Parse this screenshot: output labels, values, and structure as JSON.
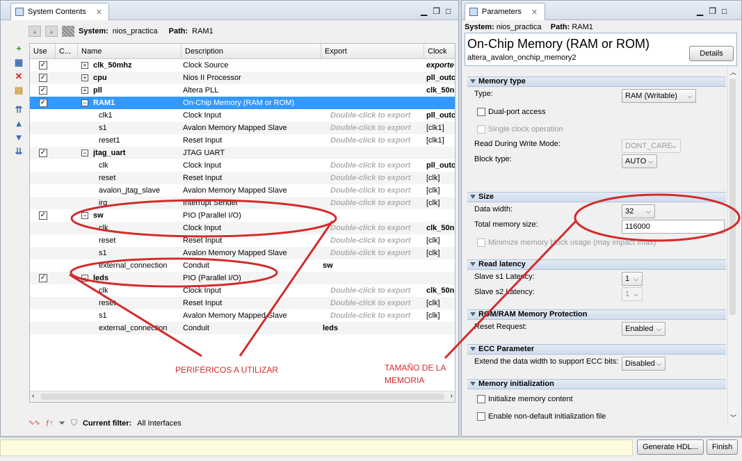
{
  "left": {
    "tab_title": "System Contents",
    "system_label": "System:",
    "system_name": "nios_practica",
    "path_label": "Path:",
    "path_value": "RAM1",
    "columns": [
      "Use",
      "C...",
      "Name",
      "Description",
      "Export",
      "Clock"
    ],
    "rows": [
      {
        "use": true,
        "expand": "+",
        "name": "clk_50mhz",
        "bold": true,
        "desc": "Clock Source",
        "export": "",
        "clock": "exporte"
      },
      {
        "use": true,
        "expand": "+",
        "name": "cpu",
        "bold": true,
        "desc": "Nios II Processor",
        "export": "",
        "clock": "pll_outc"
      },
      {
        "use": true,
        "expand": "+",
        "name": "pll",
        "bold": true,
        "desc": "Altera PLL",
        "export": "",
        "clock": "clk_50n"
      },
      {
        "use": true,
        "expand": "-",
        "name": "RAM1",
        "bold": true,
        "desc": "On-Chip Memory (RAM or ROM)",
        "export": "",
        "clock": "",
        "selected": true
      },
      {
        "name": "clk1",
        "desc": "Clock Input",
        "export": "Double-click to export",
        "clock": "pll_outc"
      },
      {
        "name": "s1",
        "desc": "Avalon Memory Mapped Slave",
        "export": "Double-click to export",
        "clock": "[clk1]"
      },
      {
        "name": "reset1",
        "desc": "Reset Input",
        "export": "Double-click to export",
        "clock": "[clk1]"
      },
      {
        "use": true,
        "expand": "-",
        "name": "jtag_uart",
        "bold": true,
        "desc": "JTAG UART",
        "export": "",
        "clock": ""
      },
      {
        "name": "clk",
        "desc": "Clock Input",
        "export": "Double-click to export",
        "clock": "pll_outc"
      },
      {
        "name": "reset",
        "desc": "Reset Input",
        "export": "Double-click to export",
        "clock": "[clk]"
      },
      {
        "name": "avalon_jtag_slave",
        "desc": "Avalon Memory Mapped Slave",
        "export": "Double-click to export",
        "clock": "[clk]"
      },
      {
        "name": "irq",
        "desc": "Interrupt Sender",
        "export": "Double-click to export",
        "clock": "[clk]"
      },
      {
        "use": true,
        "expand": "-",
        "name": "sw",
        "bold": true,
        "desc": "PIO (Parallel I/O)",
        "export": "",
        "clock": ""
      },
      {
        "name": "clk",
        "desc": "Clock Input",
        "export": "Double-click to export",
        "clock": "clk_50n"
      },
      {
        "name": "reset",
        "desc": "Reset Input",
        "export": "Double-click to export",
        "clock": "[clk]"
      },
      {
        "name": "s1",
        "desc": "Avalon Memory Mapped Slave",
        "export": "Double-click to export",
        "clock": "[clk]"
      },
      {
        "name": "external_connection",
        "desc": "Conduit",
        "export": "sw",
        "export_bold": true,
        "clock": ""
      },
      {
        "use": true,
        "expand": "-",
        "name": "leds",
        "bold": true,
        "desc": "PIO (Parallel I/O)",
        "export": "",
        "clock": ""
      },
      {
        "name": "clk",
        "desc": "Clock Input",
        "export": "Double-click to export",
        "clock": "clk_50n"
      },
      {
        "name": "reset",
        "desc": "Reset Input",
        "export": "Double-click to export",
        "clock": "[clk]"
      },
      {
        "name": "s1",
        "desc": "Avalon Memory Mapped Slave",
        "export": "Double-click to export",
        "clock": "[clk]"
      },
      {
        "name": "external_connection",
        "desc": "Conduit",
        "export": "leds",
        "export_bold": true,
        "clock": ""
      }
    ],
    "current_filter_label": "Current filter:",
    "current_filter_value": "All Interfaces"
  },
  "right": {
    "tab_title": "Parameters",
    "system_label": "System:",
    "system_name": "nios_practica",
    "path_label": "Path:",
    "path_value": "RAM1",
    "component_title": "On-Chip Memory (RAM or ROM)",
    "component_id": "altera_avalon_onchip_memory2",
    "details_button": "Details",
    "sections": {
      "memory_type": "Memory type",
      "size": "Size",
      "read_latency": "Read latency",
      "protection": "ROM/RAM Memory Protection",
      "ecc": "ECC Parameter",
      "init": "Memory initialization"
    },
    "type_label": "Type:",
    "type_value": "RAM (Writable)",
    "dual_port": "Dual-port access",
    "single_clock": "Single clock operation",
    "rdw_label": "Read During Write Mode:",
    "rdw_value": "DONT_CARE",
    "block_type_label": "Block type:",
    "block_type_value": "AUTO",
    "data_width_label": "Data width:",
    "data_width_value": "32",
    "total_size_label": "Total memory size:",
    "total_size_value": "116000",
    "minimize_label": "Minimize memory block usage (may impact fmax)",
    "s1_latency_label": "Slave s1 Latency:",
    "s1_latency_value": "1",
    "s2_latency_label": "Slave s2 Latency:",
    "s2_latency_value": "1",
    "reset_request_label": "Reset Request:",
    "reset_request_value": "Enabled",
    "ecc_label": "Extend the data width to support ECC bits:",
    "ecc_value": "Disabled",
    "init_content": "Initialize memory content",
    "nondefault_init": "Enable non-default initialization file"
  },
  "bottom": {
    "generate_button": "Generate HDL...",
    "finish_button": "Finish"
  },
  "annotations": {
    "perifericos": "PERIFÉRICOS A UTILIZAR",
    "tamano_line1": "TAMAÑO DE LA",
    "tamano_line2": "MEMORIA",
    "color": "#d42a2a"
  }
}
